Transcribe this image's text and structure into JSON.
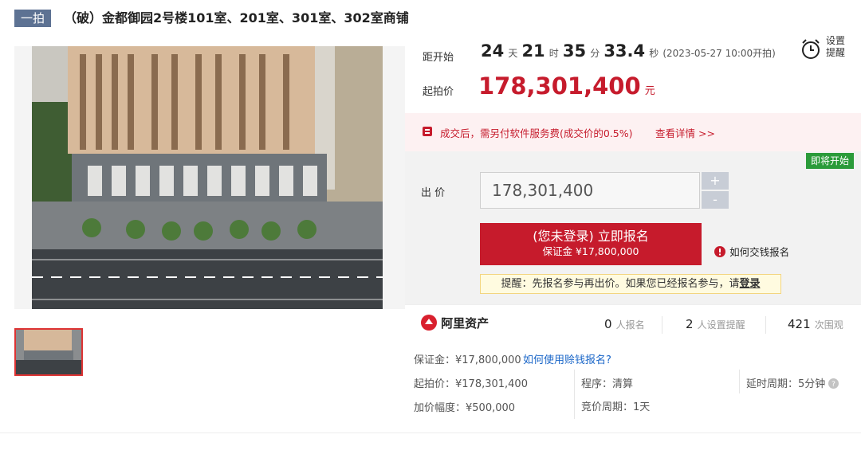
{
  "header": {
    "badge": "一拍",
    "title": "（破）金都御园2号楼101室、201室、301室、302室商铺"
  },
  "countdown": {
    "label": "距开始",
    "days": "24",
    "days_unit": "天",
    "hours": "21",
    "hours_unit": "时",
    "minutes": "35",
    "minutes_unit": "分",
    "seconds": "33.4",
    "seconds_unit": "秒",
    "start_note": "(2023-05-27 10:00开拍)"
  },
  "alarm": {
    "line1": "设置",
    "line2": "提醒"
  },
  "start_price": {
    "label": "起拍价",
    "value": "178,301,400",
    "unit": "元"
  },
  "fee_notice": {
    "text": "成交后，需另付软件服务费(成交价的0.5%)",
    "link": "查看详情 >>"
  },
  "status_tag": "即将开始",
  "bid": {
    "label": "出 价",
    "input_value": "178,301,400",
    "plus": "+",
    "minus": "-",
    "apply_line1": "(您未登录) 立即报名",
    "apply_line2": "保证金 ¥17,800,000",
    "how_to": "如何交钱报名",
    "tip_prefix": "提醒：先报名参与再出价。如果您已经报名参与，请",
    "tip_link": "登录"
  },
  "stats": {
    "brand": "阿里资产",
    "applicants_num": "0",
    "applicants_label": "人报名",
    "reminders_num": "2",
    "reminders_label": "人设置提醒",
    "views_num": "421",
    "views_label": "次围观"
  },
  "details": {
    "deposit": "保证金：¥17,800,000",
    "deposit_link": "如何使用赊钱报名?",
    "start_price": "起拍价：¥178,301,400",
    "increment": "加价幅度：¥500,000",
    "procedure": "程序：清算",
    "cycle": "竞价周期：1天",
    "delay": "延时周期：5分钟"
  },
  "colors": {
    "accent_red": "#c61b2c",
    "badge_blue": "#5d7293",
    "green_tag": "#2a9b3a",
    "link_blue": "#1a66c8"
  }
}
